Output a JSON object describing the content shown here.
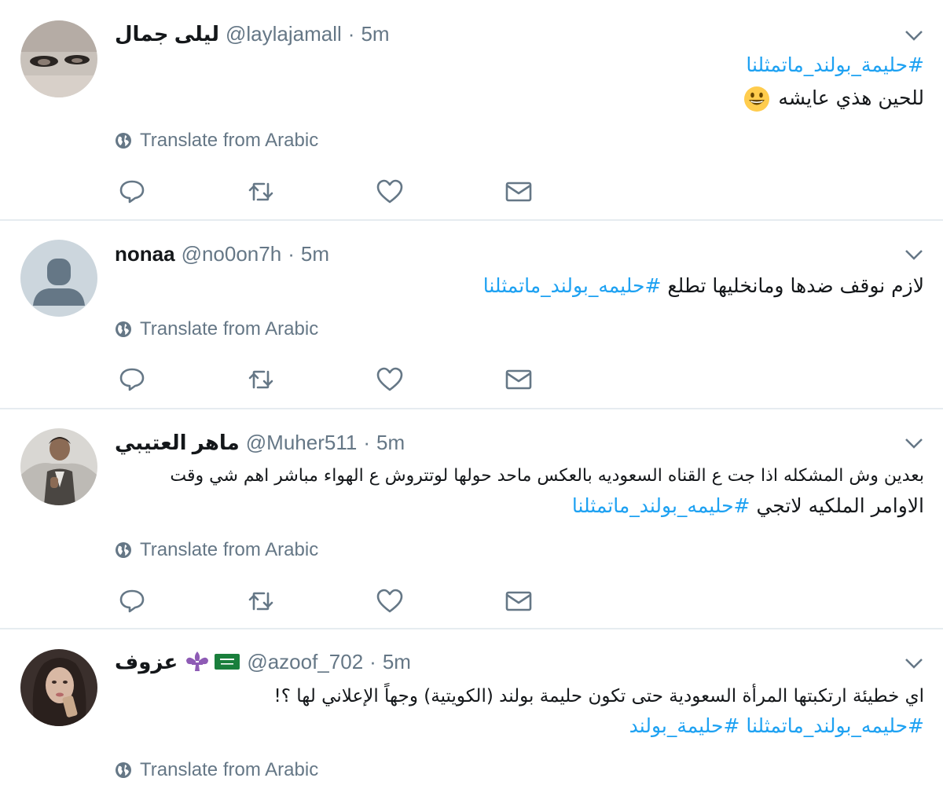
{
  "tweets": [
    {
      "name": "ليلى جمال",
      "handle": "@laylajamall",
      "time": "5m",
      "lines": [
        {
          "hashtag": "#حليمة_بولند_ماتمثلنا"
        },
        {
          "text": "للحين هذي عايشه",
          "emoji": "grinning-face"
        }
      ],
      "translate": "Translate from Arabic"
    },
    {
      "name": "nonaa",
      "handle": "@no0on7h",
      "time": "5m",
      "lines": [
        {
          "text": "لازم نوقف ضدها ومانخليها تطلع",
          "hashtag": "#حليمه_بولند_ماتمثلنا"
        }
      ],
      "translate": "Translate from Arabic"
    },
    {
      "name": "ماهر العتيبي",
      "handle": "@Muher511",
      "time": "5m",
      "lines": [
        {
          "text": "بعدين وش المشكله اذا جت ع القناه السعوديه بالعكس ماحد حولها لوتتروش ع الهواء مباشر اهم شي وقت"
        },
        {
          "text": "الاوامر الملكيه لاتجي",
          "hashtag": "#حليمه_بولند_ماتمثلنا"
        }
      ],
      "translate": "Translate from Arabic"
    },
    {
      "name": "عزوف",
      "handle": "@azoof_702",
      "time": "5m",
      "flags": [
        "saudi-flag-icon",
        "fleur-de-lis-icon"
      ],
      "lines": [
        {
          "text": "اي خطيئة ارتكبتها المرأة السعودية حتى تكون حليمة بولند (الكويتية) وجهاً الإعلاني لها ؟!"
        },
        {
          "hashtag": "#حليمه_بولند_ماتمثلنا",
          "hashtag2": "#حليمة_بولند"
        }
      ],
      "translate": "Translate from Arabic"
    }
  ],
  "colors": {
    "link": "#1da1f2",
    "secondary": "#657786",
    "divider": "#e6ecf0",
    "text": "#14171a"
  },
  "icons": {
    "actions": [
      "reply-icon",
      "retweet-icon",
      "like-icon",
      "direct-message-icon"
    ],
    "translate": "globe-icon",
    "menu": "chevron-down-icon"
  }
}
